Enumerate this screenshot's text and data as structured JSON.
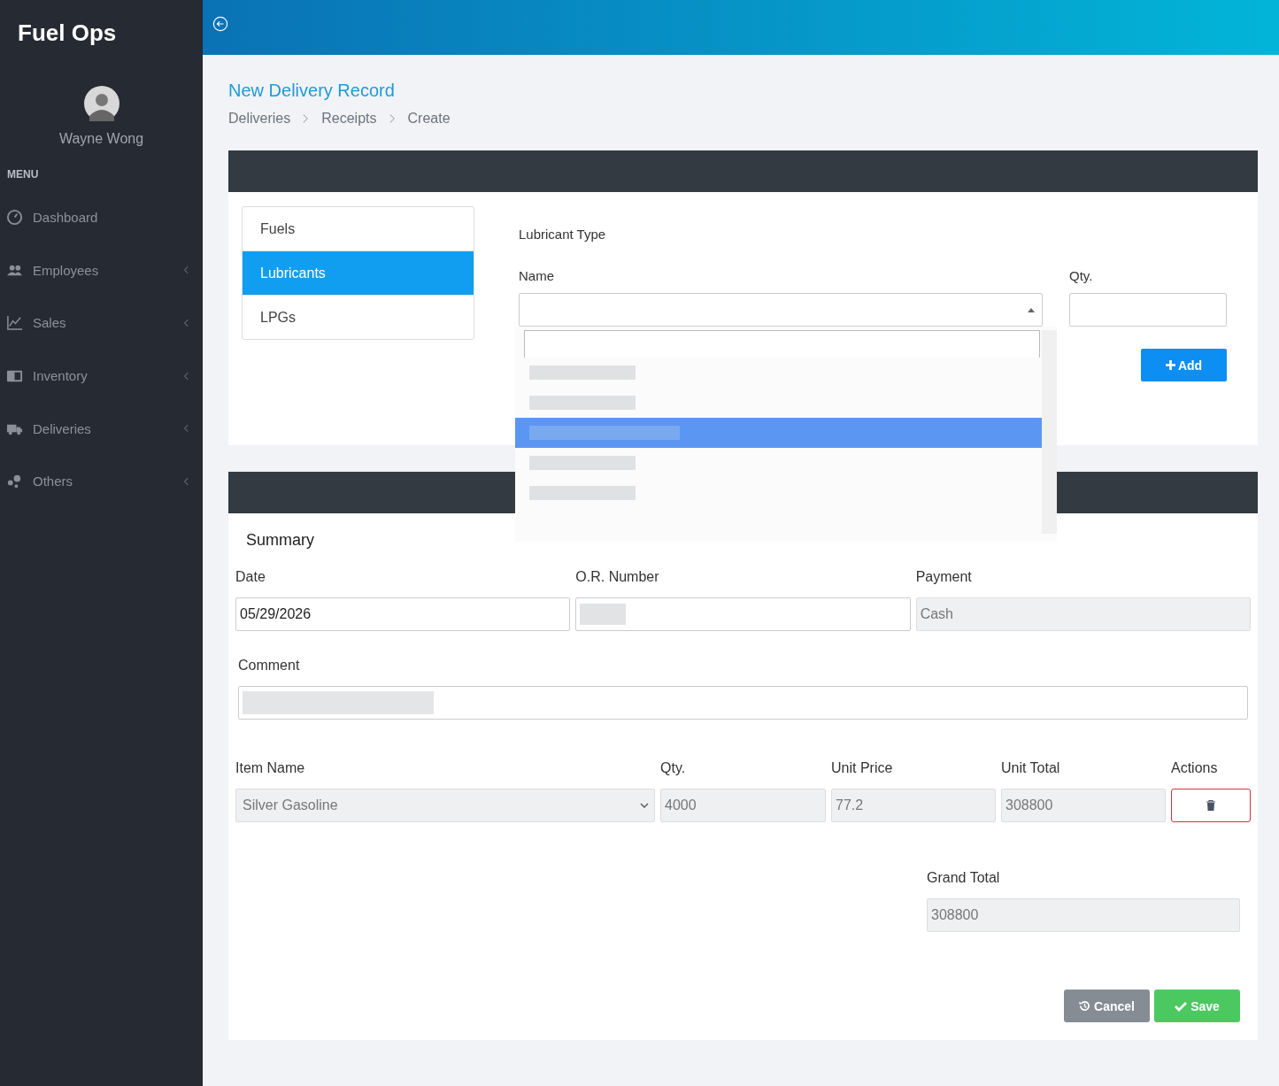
{
  "brand": "Fuel Ops",
  "user": {
    "name": "Wayne Wong"
  },
  "menu_heading": "MENU",
  "nav": [
    {
      "label": "Dashboard",
      "expandable": false
    },
    {
      "label": "Employees",
      "expandable": true
    },
    {
      "label": "Sales",
      "expandable": true
    },
    {
      "label": "Inventory",
      "expandable": true
    },
    {
      "label": "Deliveries",
      "expandable": true
    },
    {
      "label": "Others",
      "expandable": true
    }
  ],
  "page_title": "New Delivery Record",
  "breadcrumb": [
    "Deliveries",
    "Receipts",
    "Create"
  ],
  "categories": [
    {
      "label": "Fuels",
      "selected": false
    },
    {
      "label": "Lubricants",
      "selected": true
    },
    {
      "label": "LPGs",
      "selected": false
    }
  ],
  "lubricant_form": {
    "heading": "Lubricant Type",
    "name_label": "Name",
    "qty_label": "Qty.",
    "add_button": "Add",
    "dropdown": {
      "open": true,
      "options": [
        {
          "selected": false
        },
        {
          "selected": false
        },
        {
          "selected": true
        },
        {
          "selected": false
        },
        {
          "selected": false
        }
      ]
    }
  },
  "summary": {
    "title": "Summary",
    "fields": [
      {
        "label": "Date",
        "value": "05/29/2026",
        "readonly": false,
        "blurred": false
      },
      {
        "label": "O.R. Number",
        "readonly": false,
        "blurred": true
      },
      {
        "label": "Payment",
        "value": "Cash",
        "readonly": true,
        "blurred": false
      }
    ],
    "comment": {
      "label": "Comment",
      "blurred": true
    },
    "columns": [
      "Item Name",
      "Qty.",
      "Unit Price",
      "Unit Total",
      "Actions"
    ],
    "rows": [
      {
        "item": "Silver Gasoline",
        "qty": "4000",
        "unit_price": "77.2",
        "unit_total": "308800"
      }
    ],
    "grand_total": {
      "label": "Grand Total",
      "value": "308800"
    },
    "buttons": {
      "cancel": "Cancel",
      "save": "Save"
    }
  }
}
